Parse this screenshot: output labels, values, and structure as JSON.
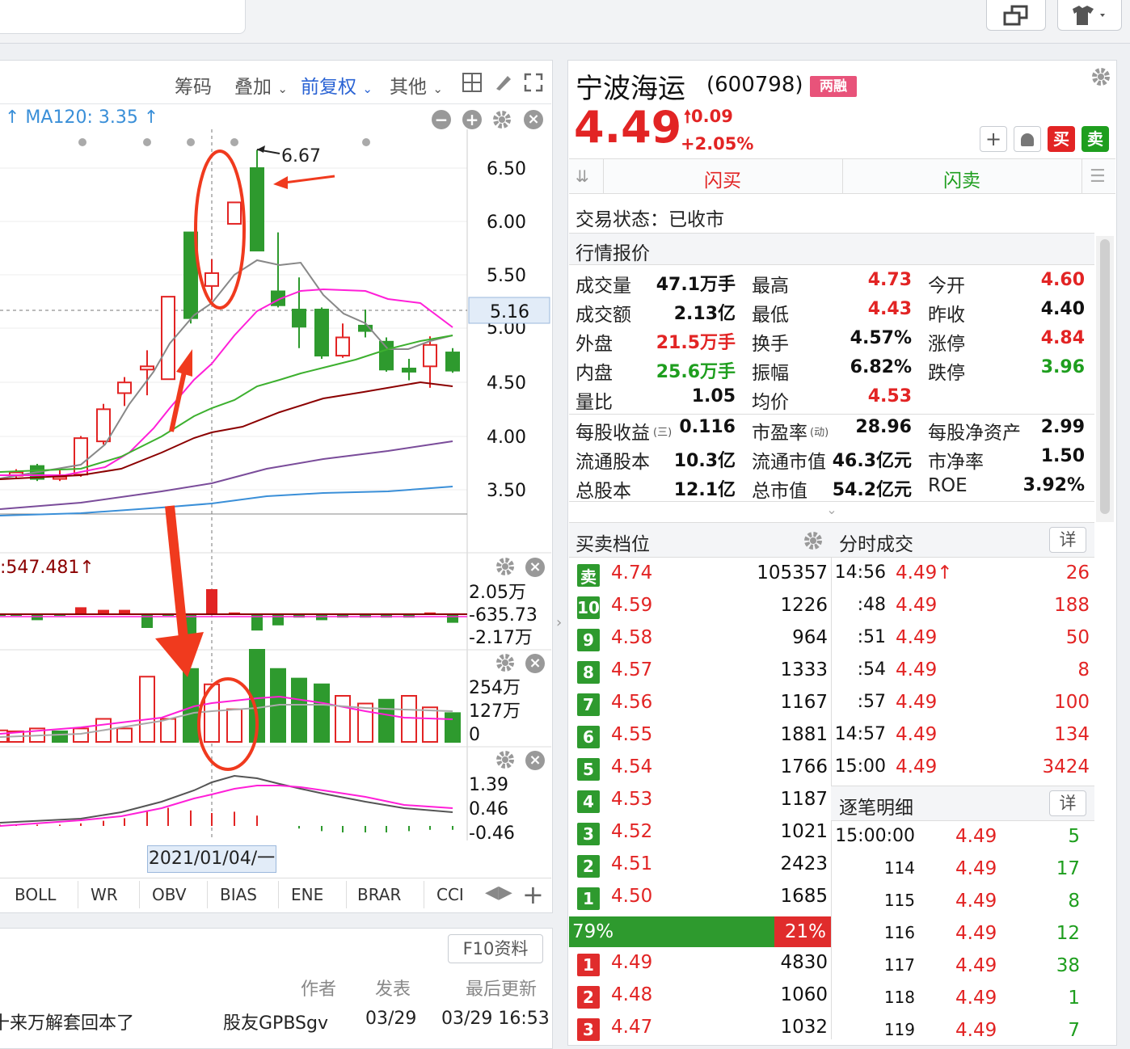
{
  "toolbar": {
    "chip": "筹码",
    "overlay": "叠加",
    "adjust": "前复权",
    "other": "其他"
  },
  "ma120": "↑  MA120: 3.35 ↑",
  "price_axis": [
    "6.50",
    "6.00",
    "5.50",
    "5.16",
    "5.00",
    "4.50",
    "4.00",
    "3.50"
  ],
  "high_label": "6.67",
  "macd": {
    "label": ":547.481↑",
    "axis": [
      "2.05万",
      "-635.73",
      "-2.17万"
    ]
  },
  "vol_axis": [
    "254万",
    "127万",
    "0"
  ],
  "kdj_axis": [
    "1.39",
    "0.46",
    "-0.46"
  ],
  "date_label": "2021/01/04/一",
  "indicator_tabs": [
    "BOLL",
    "WR",
    "OBV",
    "BIAS",
    "ENE",
    "BRAR",
    "CCI"
  ],
  "forum": {
    "f10": "F10资料",
    "headers": [
      "作者",
      "发表",
      "最后更新"
    ],
    "row": {
      "title": "十来万解套回本了",
      "author": "股友GPBSgv",
      "date": "03/29",
      "updated": "03/29 16:53"
    }
  },
  "stock": {
    "name": "宁波海运",
    "code": "(600798)",
    "tag": "两融",
    "price": "4.49",
    "change": "0.09",
    "pct": "+2.05%",
    "buy": "买",
    "sell": "卖"
  },
  "flash": {
    "buy": "闪买",
    "sell": "闪卖"
  },
  "status": "交易状态：已收市",
  "quote_title": "行情报价",
  "quote": [
    [
      "成交量",
      "47.1万手",
      "blk",
      "最高",
      "4.73",
      "red",
      "今开",
      "4.60",
      "red"
    ],
    [
      "成交额",
      "2.13亿",
      "blk",
      "最低",
      "4.43",
      "red",
      "昨收",
      "4.40",
      "blk"
    ],
    [
      "外盘",
      "21.5万手",
      "red",
      "换手",
      "4.57%",
      "blk",
      "涨停",
      "4.84",
      "red"
    ],
    [
      "内盘",
      "25.6万手",
      "grn",
      "振幅",
      "6.82%",
      "blk",
      "跌停",
      "3.96",
      "grn"
    ],
    [
      "量比",
      "1.05",
      "blk",
      "均价",
      "4.53",
      "red",
      "",
      "",
      " "
    ]
  ],
  "fund": [
    [
      "每股收益",
      "0.116",
      "市盈率",
      "28.96",
      "每股净资产",
      "2.99"
    ],
    [
      "流通股本",
      "10.3亿",
      "流通市值",
      "46.3亿元",
      "市净率",
      "1.50"
    ],
    [
      "总股本",
      "12.1亿",
      "总市值",
      "54.2亿元",
      "ROE",
      "3.92%"
    ]
  ],
  "fund_sub": {
    "eps": "(三)",
    "pe": "(动)"
  },
  "orderbook_title": "买卖档位",
  "asks": [
    [
      "卖",
      "4.74",
      "105357"
    ],
    [
      "10",
      "4.59",
      "1226"
    ],
    [
      "9",
      "4.58",
      "964"
    ],
    [
      "8",
      "4.57",
      "1333"
    ],
    [
      "7",
      "4.56",
      "1167"
    ],
    [
      "6",
      "4.55",
      "1881"
    ],
    [
      "5",
      "4.54",
      "1766"
    ],
    [
      "4",
      "4.53",
      "1187"
    ],
    [
      "3",
      "4.52",
      "1021"
    ],
    [
      "2",
      "4.51",
      "2423"
    ],
    [
      "1",
      "4.50",
      "1685"
    ]
  ],
  "ratio": {
    "left": "79%",
    "right": "21%"
  },
  "bids": [
    [
      "1",
      "4.49",
      "4830"
    ],
    [
      "2",
      "4.48",
      "1060"
    ],
    [
      "3",
      "4.47",
      "1032"
    ]
  ],
  "ticks_title": "分时成交",
  "detail": "详",
  "ticks": [
    [
      "14:56",
      "4.49↑",
      "26"
    ],
    [
      ":48",
      "4.49",
      "188"
    ],
    [
      ":51",
      "4.49",
      "50"
    ],
    [
      ":54",
      "4.49",
      "8"
    ],
    [
      ":57",
      "4.49",
      "100"
    ],
    [
      "14:57",
      "4.49",
      "134"
    ],
    [
      "15:00",
      "4.49",
      "3424"
    ]
  ],
  "trades_title": "逐笔明细",
  "trades": [
    [
      "15:00:00",
      "4.49",
      "5"
    ],
    [
      "114",
      "4.49",
      "17"
    ],
    [
      "115",
      "4.49",
      "8"
    ],
    [
      "116",
      "4.49",
      "12"
    ],
    [
      "117",
      "4.49",
      "38"
    ],
    [
      "118",
      "4.49",
      "1"
    ],
    [
      "119",
      "4.49",
      "7"
    ]
  ]
}
